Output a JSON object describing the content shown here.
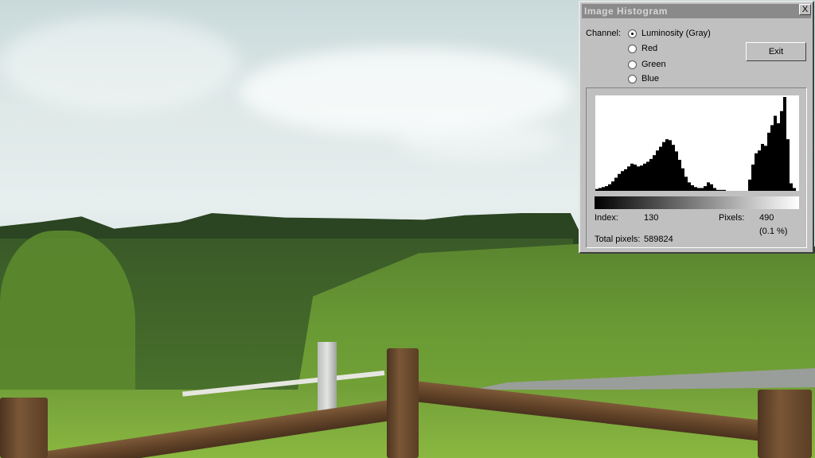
{
  "dialog": {
    "title": "Image Histogram",
    "close_label": "X",
    "channel_label": "Channel:",
    "channels": [
      {
        "label": "Luminosity (Gray)",
        "selected": true
      },
      {
        "label": "Red",
        "selected": false
      },
      {
        "label": "Green",
        "selected": false
      },
      {
        "label": "Blue",
        "selected": false
      }
    ],
    "exit_label": "Exit",
    "index_label": "Index:",
    "index_value": "130",
    "pixels_label": "Pixels:",
    "pixels_value": "490",
    "pixels_percent": "(0.1 %)",
    "total_label": "Total pixels:",
    "total_value": "589824"
  },
  "histogram": {
    "bins": 64,
    "range": [
      0,
      255
    ],
    "relative_heights": [
      2,
      3,
      4,
      5,
      7,
      10,
      14,
      18,
      21,
      23,
      26,
      29,
      28,
      26,
      27,
      29,
      31,
      34,
      38,
      43,
      47,
      52,
      55,
      54,
      49,
      42,
      33,
      24,
      15,
      9,
      6,
      4,
      3,
      3,
      5,
      9,
      7,
      3,
      1,
      1,
      1,
      0,
      0,
      0,
      0,
      0,
      0,
      0,
      12,
      28,
      40,
      43,
      50,
      48,
      62,
      70,
      80,
      72,
      85,
      100,
      55,
      8,
      3,
      0
    ]
  }
}
